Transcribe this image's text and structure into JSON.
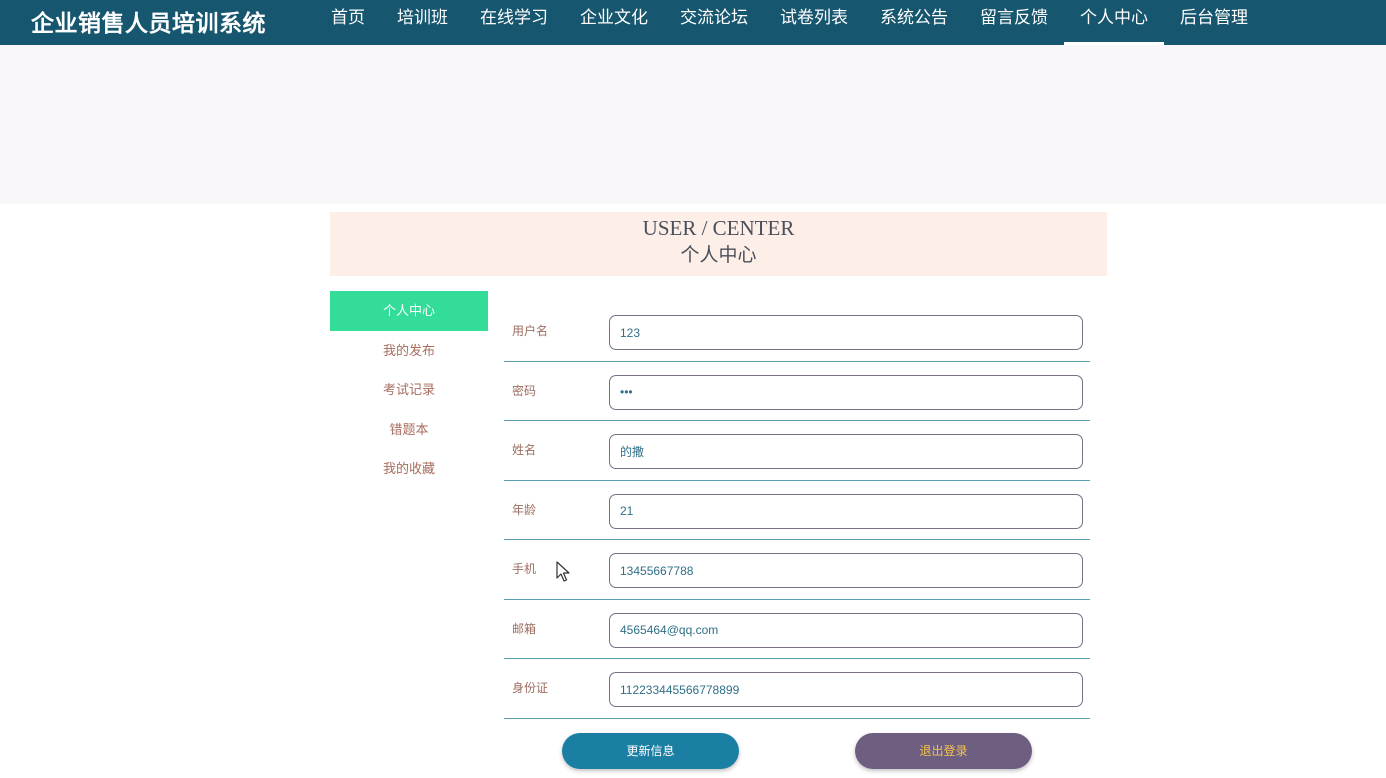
{
  "app": {
    "title": "企业销售人员培训系统"
  },
  "nav": {
    "items": [
      {
        "label": "首页"
      },
      {
        "label": "培训班"
      },
      {
        "label": "在线学习"
      },
      {
        "label": "企业文化"
      },
      {
        "label": "交流论坛"
      },
      {
        "label": "试卷列表"
      },
      {
        "label": "系统公告"
      },
      {
        "label": "留言反馈"
      },
      {
        "label": "个人中心",
        "active": true
      },
      {
        "label": "后台管理"
      }
    ]
  },
  "section": {
    "title_en": "USER / CENTER",
    "title_cn": "个人中心"
  },
  "sidebar": {
    "items": [
      {
        "label": "个人中心",
        "active": true
      },
      {
        "label": "我的发布"
      },
      {
        "label": "考试记录"
      },
      {
        "label": "错题本"
      },
      {
        "label": "我的收藏"
      }
    ]
  },
  "form": {
    "fields": [
      {
        "label": "用户名",
        "value": "123"
      },
      {
        "label": "密码",
        "value": "•••"
      },
      {
        "label": "姓名",
        "value": "的撒"
      },
      {
        "label": "年龄",
        "value": "21"
      },
      {
        "label": "手机",
        "value": "13455667788"
      },
      {
        "label": "邮箱",
        "value": "4565464@qq.com"
      },
      {
        "label": "身份证",
        "value": "112233445566778899"
      }
    ]
  },
  "buttons": {
    "update": "更新信息",
    "logout": "退出登录"
  },
  "colors": {
    "topbar": "#16566f",
    "active_sidebar": "#33dd99",
    "update_button": "#1b7ea3",
    "logout_button": "#6e5e80",
    "logout_text": "#f3c34f"
  }
}
